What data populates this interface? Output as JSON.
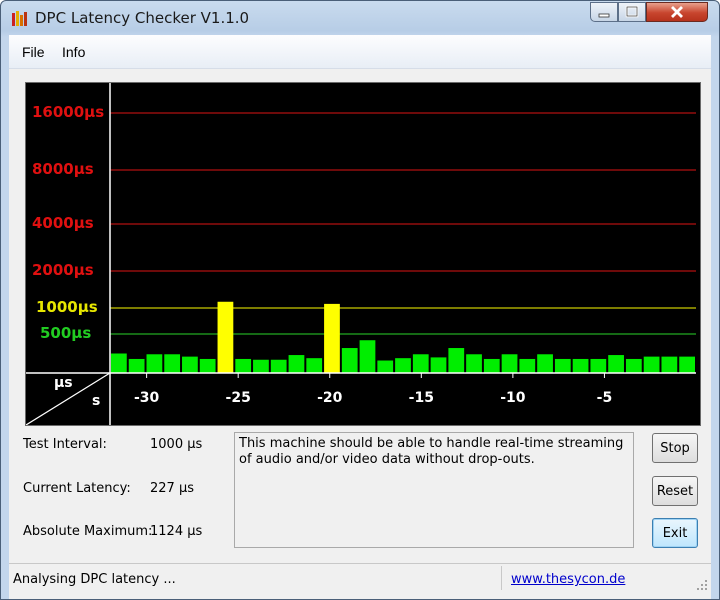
{
  "window": {
    "title": "DPC Latency Checker V1.1.0"
  },
  "menu": {
    "items": [
      "File",
      "Info"
    ]
  },
  "chart_data": {
    "type": "bar",
    "y_labels": [
      {
        "text": "16000µs",
        "color": "#e01010",
        "gridline": "#b01010"
      },
      {
        "text": "8000µs",
        "color": "#e01010",
        "gridline": "#b01010"
      },
      {
        "text": "4000µs",
        "color": "#e01010",
        "gridline": "#b01010"
      },
      {
        "text": "2000µs",
        "color": "#e01010",
        "gridline": "#b01010"
      },
      {
        "text": "1000µs",
        "color": "#e6e600",
        "gridline": "#c8c800"
      },
      {
        "text": "500µs",
        "color": "#22cc22",
        "gridline": "#22aa22"
      }
    ],
    "corner_labels": {
      "y_unit": "µs",
      "x_unit": "s"
    },
    "x_ticks": [
      {
        "label": "-30",
        "x": -30
      },
      {
        "label": "-25",
        "x": -25
      },
      {
        "label": "-20",
        "x": -20
      },
      {
        "label": "-15",
        "x": -15
      },
      {
        "label": "-10",
        "x": -10
      },
      {
        "label": "-5",
        "x": -5
      }
    ],
    "x_range": [
      -32,
      0
    ],
    "values_us": [
      250,
      180,
      240,
      240,
      210,
      180,
      1124,
      180,
      170,
      170,
      230,
      190,
      1080,
      320,
      420,
      160,
      190,
      240,
      200,
      320,
      240,
      180,
      240,
      180,
      240,
      180,
      180,
      180,
      230,
      180,
      210,
      210,
      210
    ],
    "colors": {
      "normal": "#00ee00",
      "warning": "#ffff00"
    },
    "warning_threshold_us": 1000
  },
  "stats": {
    "test_interval": {
      "label": "Test Interval:",
      "value": "1000 µs"
    },
    "current_latency": {
      "label": "Current Latency:",
      "value": "227 µs"
    },
    "absolute_maximum": {
      "label": "Absolute Maximum:",
      "value": "1124 µs"
    }
  },
  "message": "This machine should be able to handle real-time streaming of audio and/or video data without drop-outs.",
  "buttons": {
    "stop": "Stop",
    "reset": "Reset",
    "exit": "Exit"
  },
  "status": {
    "text": "Analysing DPC latency ...",
    "link": "www.thesycon.de"
  }
}
